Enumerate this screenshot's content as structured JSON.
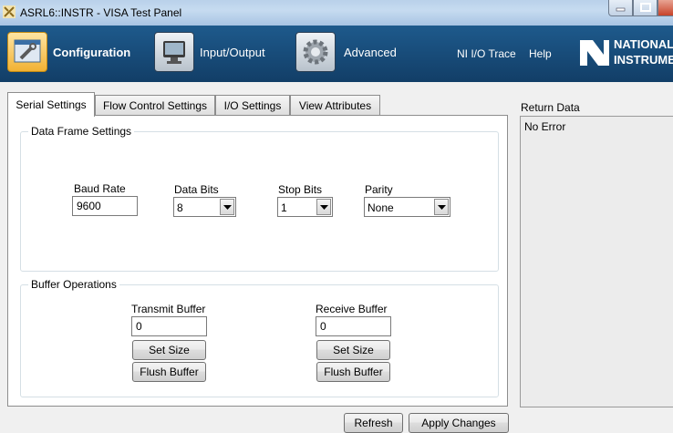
{
  "window": {
    "title": "ASRL6::INSTR - VISA Test Panel"
  },
  "toolbar": {
    "configuration": "Configuration",
    "input_output": "Input/Output",
    "advanced": "Advanced",
    "ni_io_trace": "NI I/O Trace",
    "help": "Help",
    "logo_line1": "NATIONAL",
    "logo_line2": "INSTRUMENTS"
  },
  "tabs": [
    {
      "label": "Serial Settings",
      "active": true
    },
    {
      "label": "Flow Control Settings",
      "active": false
    },
    {
      "label": "I/O Settings",
      "active": false
    },
    {
      "label": "View Attributes",
      "active": false
    }
  ],
  "data_frame": {
    "title": "Data Frame Settings",
    "baud_rate": {
      "label": "Baud Rate",
      "value": "9600"
    },
    "data_bits": {
      "label": "Data Bits",
      "value": "8"
    },
    "stop_bits": {
      "label": "Stop Bits",
      "value": "1"
    },
    "parity": {
      "label": "Parity",
      "value": "None"
    }
  },
  "buffer_ops": {
    "title": "Buffer Operations",
    "transmit": {
      "label": "Transmit Buffer",
      "value": "0",
      "set_size": "Set Size",
      "flush": "Flush Buffer"
    },
    "receive": {
      "label": "Receive Buffer",
      "value": "0",
      "set_size": "Set Size",
      "flush": "Flush Buffer"
    }
  },
  "footer": {
    "refresh": "Refresh",
    "apply": "Apply Changes"
  },
  "return_data": {
    "label": "Return Data",
    "text": "No Error"
  },
  "icons": [
    "app-icon",
    "configuration-icon",
    "input-output-icon",
    "advanced-gear-icon",
    "ni-logo-icon",
    "chevron-down-icon"
  ],
  "colors": {
    "toolbar": "#1a4f7e",
    "titlebar": "#b9d1ea",
    "active_tab": "#ffffff",
    "return_bg": "#ececec"
  }
}
